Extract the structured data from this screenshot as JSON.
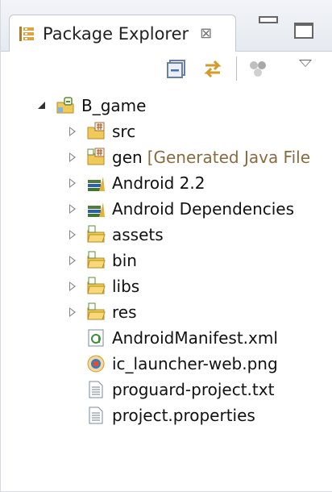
{
  "view": {
    "title": "Package Explorer",
    "close_glyph": "⊠"
  },
  "toolbar": {
    "items": [
      "collapse-all-icon",
      "link-with-editor-icon",
      "filters-icon",
      "view-menu-icon"
    ]
  },
  "tree": {
    "project": {
      "label": "B_game",
      "expanded": true,
      "icon": "android-project-icon"
    },
    "children": [
      {
        "label": "src",
        "decoration": "",
        "icon": "source-folder-icon",
        "expandable": true
      },
      {
        "label": "gen",
        "decoration": "[Generated Java File",
        "icon": "generated-source-folder-icon",
        "expandable": true
      },
      {
        "label": "Android 2.2",
        "decoration": "",
        "icon": "library-icon",
        "expandable": true
      },
      {
        "label": "Android Dependencies",
        "decoration": "",
        "icon": "library-icon",
        "expandable": true
      },
      {
        "label": "assets",
        "decoration": "",
        "icon": "folder-icon",
        "expandable": true
      },
      {
        "label": "bin",
        "decoration": "",
        "icon": "folder-icon",
        "expandable": true
      },
      {
        "label": "libs",
        "decoration": "",
        "icon": "folder-icon",
        "expandable": true
      },
      {
        "label": "res",
        "decoration": "",
        "icon": "folder-icon",
        "expandable": true
      },
      {
        "label": "AndroidManifest.xml",
        "decoration": "",
        "icon": "xml-file-icon",
        "expandable": false
      },
      {
        "label": "ic_launcher-web.png",
        "decoration": "",
        "icon": "image-file-icon",
        "expandable": false
      },
      {
        "label": "proguard-project.txt",
        "decoration": "",
        "icon": "text-file-icon",
        "expandable": false
      },
      {
        "label": "project.properties",
        "decoration": "",
        "icon": "text-file-icon",
        "expandable": false
      }
    ]
  },
  "colors": {
    "decoration": "#8a6b3f",
    "folder": "#e8c25a",
    "library": "#4b7f3a"
  }
}
